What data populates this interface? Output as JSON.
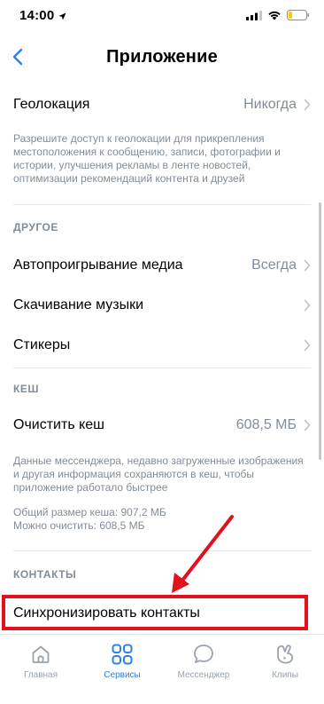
{
  "status": {
    "time": "14:00"
  },
  "nav": {
    "title": "Приложение",
    "back_icon": "chevron-left-icon"
  },
  "settings": {
    "geolocation": {
      "label": "Геолокация",
      "value": "Никогда"
    },
    "geolocation_caption": "Разрешите доступ к геолокации для прикрепления местоположения к сообщению, записи, фотографии и истории, улучшения рекламы в ленте новостей, оптимизации рекомендаций контента и друзей",
    "other_header": "ДРУГОЕ",
    "autoplay": {
      "label": "Автопроигрывание медиа",
      "value": "Всегда"
    },
    "music_download": {
      "label": "Скачивание музыки"
    },
    "stickers": {
      "label": "Стикеры"
    },
    "cache_header": "КЕШ",
    "clear_cache": {
      "label": "Очистить кеш",
      "value": "608,5 МБ"
    },
    "cache_caption": "Данные мессенджера, недавно загруженные изображения и другая информация сохраняются в кеш, чтобы приложение работало быстрее",
    "cache_total": "Общий размер кеша: 907,2 МБ",
    "cache_clearable": "Можно очистить: 608,5 МБ",
    "contacts_header": "КОНТАКТЫ",
    "sync_contacts": {
      "label": "Синхронизировать контакты"
    }
  },
  "tabs": [
    {
      "label": "Главная",
      "icon": "home-icon",
      "active": false
    },
    {
      "label": "Сервисы",
      "icon": "services-icon",
      "active": true
    },
    {
      "label": "Мессенджер",
      "icon": "messenger-icon",
      "active": false
    },
    {
      "label": "Клипы",
      "icon": "clips-icon",
      "active": false
    }
  ],
  "colors": {
    "accent": "#2d81e0",
    "highlight": "#e3101e",
    "secondary_text": "#818c99"
  }
}
